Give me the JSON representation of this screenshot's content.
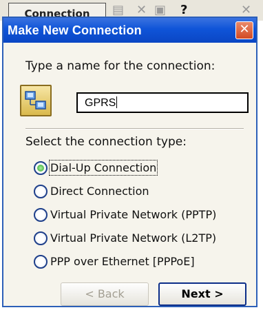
{
  "background": {
    "tab_label": "Connection",
    "icons": [
      "toolbar-icon",
      "delete-icon",
      "properties-icon",
      "help-icon",
      "close-icon"
    ]
  },
  "dialog": {
    "title": "Make New Connection",
    "close_label": "✕",
    "name_prompt": "Type a name for the connection:",
    "name_value": "GPRS",
    "type_prompt": "Select the connection type:",
    "options": [
      {
        "label": "Dial-Up Connection",
        "checked": true
      },
      {
        "label": "Direct Connection",
        "checked": false
      },
      {
        "label": "Virtual Private Network (PPTP)",
        "checked": false
      },
      {
        "label": "Virtual Private Network (L2TP)",
        "checked": false
      },
      {
        "label": "PPP over Ethernet [PPPoE]",
        "checked": false
      }
    ],
    "back_label": "< Back",
    "next_label": "Next >"
  },
  "colors": {
    "titlebar": "#0f54d8",
    "dialog_bg": "#f6f4ec",
    "radio_checked": "#2aa52a"
  }
}
